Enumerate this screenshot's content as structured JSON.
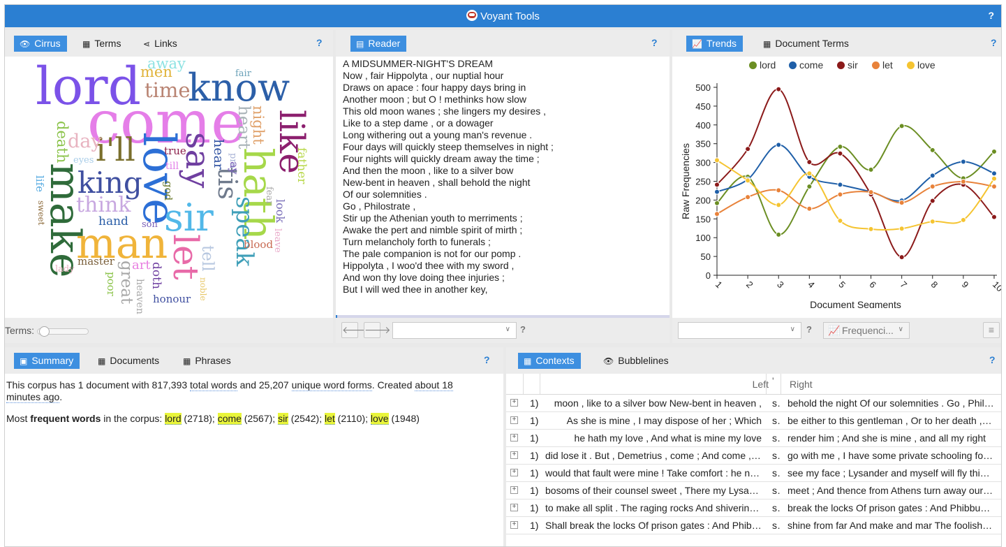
{
  "app": {
    "title": "Voyant Tools",
    "help": "?"
  },
  "cirrus_panel": {
    "tabs": [
      "Cirrus",
      "Terms",
      "Links"
    ],
    "terms_label": "Terms:",
    "words": [
      {
        "t": "lord",
        "c": "#7b52e8"
      },
      {
        "t": "come",
        "c": "#e57ee8"
      },
      {
        "t": "know",
        "c": "#2c5fa8"
      },
      {
        "t": "men",
        "c": "#e0b33a"
      },
      {
        "t": "away",
        "c": "#8ee3e3"
      },
      {
        "t": "time",
        "c": "#b98473"
      },
      {
        "t": "fair",
        "c": "#6aa1b8"
      },
      {
        "t": "like",
        "c": "#8c1f6e"
      },
      {
        "t": "night",
        "c": "#e0a16a"
      },
      {
        "t": "heart",
        "c": "#a9b3b8"
      },
      {
        "t": "hath",
        "c": "#a6d84a"
      },
      {
        "t": "say",
        "c": "#6f3fa0"
      },
      {
        "t": "love",
        "c": "#2c6fd6"
      },
      {
        "t": "i'll",
        "c": "#7a6f2c"
      },
      {
        "t": "day",
        "c": "#e8b3c0"
      },
      {
        "t": "death",
        "c": "#8bc34a"
      },
      {
        "t": "eyes",
        "c": "#a8cde8"
      },
      {
        "t": "true",
        "c": "#8c1f4a"
      },
      {
        "t": "till",
        "c": "#e27ee8"
      },
      {
        "t": "king",
        "c": "#3f4fa0"
      },
      {
        "t": "make",
        "c": "#2f6b3a"
      },
      {
        "t": "think",
        "c": "#c8a8e0"
      },
      {
        "t": "god",
        "c": "#6b7a2c"
      },
      {
        "t": "sir",
        "c": "#52b8e8"
      },
      {
        "t": "tis",
        "c": "#6f7a8c"
      },
      {
        "t": "speak",
        "c": "#3f9fb8"
      },
      {
        "t": "hear",
        "c": "#2c4fa0"
      },
      {
        "t": "pray",
        "c": "#a8b3d6"
      },
      {
        "t": "ay",
        "c": "#7a5fb8"
      },
      {
        "t": "father",
        "c": "#b8d84a"
      },
      {
        "t": "life",
        "c": "#52a8e0"
      },
      {
        "t": "sweet",
        "c": "#8c6a3a"
      },
      {
        "t": "hand",
        "c": "#2c5fa8"
      },
      {
        "t": "man",
        "c": "#f0b43a"
      },
      {
        "t": "son",
        "c": "#7a5fb8"
      },
      {
        "t": "let",
        "c": "#e86aa8"
      },
      {
        "t": "fear",
        "c": "#a8a8a8"
      },
      {
        "t": "look",
        "c": "#7a6fb8"
      },
      {
        "t": "leave",
        "c": "#e8a8c8"
      },
      {
        "t": "blood",
        "c": "#c86a52"
      },
      {
        "t": "tell",
        "c": "#b8c8e0"
      },
      {
        "t": "noble",
        "c": "#e8c86a"
      },
      {
        "t": "doth",
        "c": "#6f3fa0"
      },
      {
        "t": "art",
        "c": "#e87ee0"
      },
      {
        "t": "master",
        "c": "#7a5f3a"
      },
      {
        "t": "great",
        "c": "#a8a8a8"
      },
      {
        "t": "poor",
        "c": "#8bc34a"
      },
      {
        "t": "heaven",
        "c": "#a8a8a8"
      },
      {
        "t": "lady",
        "c": "#e8b3c0"
      },
      {
        "t": "honour",
        "c": "#3f4fa0"
      }
    ]
  },
  "reader_panel": {
    "tab": "Reader",
    "lines": [
      "A MIDSUMMER-NIGHT'S DREAM",
      "Now , fair Hippolyta , our nuptial hour",
      "Draws on apace : four happy days bring in",
      "Another moon ; but O ! methinks how slow",
      "This old moon wanes ; she lingers my desires ,",
      "Like to a step dame , or a dowager",
      "Long withering out a young man's revenue .",
      "Four days will quickly steep themselves in night ;",
      "Four nights will quickly dream away the time ;",
      "And then the moon , like to a silver bow",
      "New-bent in heaven , shall behold the night",
      "Of our solemnities .",
      "Go , Philostrate ,",
      "Stir up the Athenian youth to merriments ;",
      "Awake the pert and nimble spirit of mirth ;",
      "Turn melancholy forth to funerals ;",
      "The pale companion is not for our pomp .",
      "Hippolyta , I woo'd thee with my sword ,",
      "And won thy love doing thee injuries ;",
      "But I will wed thee in another key,"
    ],
    "help": "?"
  },
  "trends_panel": {
    "tabs": [
      "Trends",
      "Document Terms"
    ],
    "freq_label": "Frequenci...",
    "chart_data": {
      "type": "line",
      "x": [
        1,
        2,
        3,
        4,
        5,
        6,
        7,
        8,
        9,
        10
      ],
      "xlabel": "Document Segments",
      "ylabel": "Raw Frequencies",
      "ylim": [
        0,
        500
      ],
      "yticks": [
        0,
        50,
        100,
        150,
        200,
        250,
        300,
        350,
        400,
        450,
        500
      ],
      "legend_position": "top",
      "series": [
        {
          "name": "lord",
          "color": "#6b8e23",
          "values": [
            192,
            262,
            108,
            236,
            342,
            281,
            397,
            333,
            258,
            329
          ]
        },
        {
          "name": "come",
          "color": "#1f5fa8",
          "values": [
            222,
            255,
            347,
            262,
            241,
            222,
            199,
            265,
            302,
            271
          ]
        },
        {
          "name": "sir",
          "color": "#8b1a1a",
          "values": [
            241,
            336,
            495,
            301,
            324,
            215,
            48,
            198,
            241,
            155
          ]
        },
        {
          "name": "let",
          "color": "#e8823a",
          "values": [
            163,
            208,
            226,
            177,
            215,
            221,
            193,
            236,
            249,
            236
          ]
        },
        {
          "name": "love",
          "color": "#f5c431",
          "values": [
            306,
            252,
            187,
            271,
            145,
            123,
            124,
            143,
            147,
            257
          ]
        }
      ]
    }
  },
  "summary_panel": {
    "tabs": [
      "Summary",
      "Documents",
      "Phrases"
    ],
    "s1_a": "This corpus has 1 document with 817,393 ",
    "s1_total": "total words",
    "s1_b": " and 25,207 ",
    "s1_unique": "unique word forms",
    "s1_c": ". Created ",
    "s1_created": "about 18 minutes ago",
    "s1_d": ".",
    "s2_a": "Most ",
    "s2_bold": "frequent words",
    "s2_b": " in the corpus: ",
    "freq": [
      {
        "w": "lord",
        "n": " (2718); "
      },
      {
        "w": "come",
        "n": " (2567); "
      },
      {
        "w": "sir",
        "n": " (2542); "
      },
      {
        "w": "let",
        "n": " (2110); "
      },
      {
        "w": "love",
        "n": " (1948)"
      }
    ]
  },
  "contexts_panel": {
    "tabs": [
      "Contexts",
      "Bubblelines"
    ],
    "head_left": "Left",
    "head_mid": "'",
    "head_right": "Right",
    "rows": [
      {
        "doc": "1)",
        "left": "moon , like to a silver bow New-bent in heaven ,",
        "term": "sh",
        "right": "behold the night Of our solemnities . Go , Philostrate"
      },
      {
        "doc": "1)",
        "left": "As she is mine , I may dispose of her ; Which",
        "term": "sh",
        "right": "be either to this gentleman , Or to her death , according"
      },
      {
        "doc": "1)",
        "left": "he hath my love , And what is mine my love",
        "term": "sh",
        "right": "render him ; And she is mine , and all my right"
      },
      {
        "doc": "1)",
        "left": "did lose it . But , Demetrius , come ; And come , Egeus",
        "term": "sh",
        "right": "go with me , I have some private schooling for you both"
      },
      {
        "doc": "1)",
        "left": "would that fault were mine ! Take comfort : he no more",
        "term": "sh",
        "right": "see my face ; Lysander and myself will fly this place"
      },
      {
        "doc": "1)",
        "left": "bosoms of their counsel sweet , There my Lysander and myself",
        "term": "sh",
        "right": "meet ; And thence from Athens turn away our eyes"
      },
      {
        "doc": "1)",
        "left": "to make all split . The raging rocks And shivering shocks",
        "term": "sh",
        "right": "break the locks Of prison gates : And Phibbus' car"
      },
      {
        "doc": "1)",
        "left": "Shall break the locks Of prison gates : And Phibbus' car",
        "term": "sh",
        "right": "shine from far And make and mar The foolish Fates"
      }
    ]
  }
}
